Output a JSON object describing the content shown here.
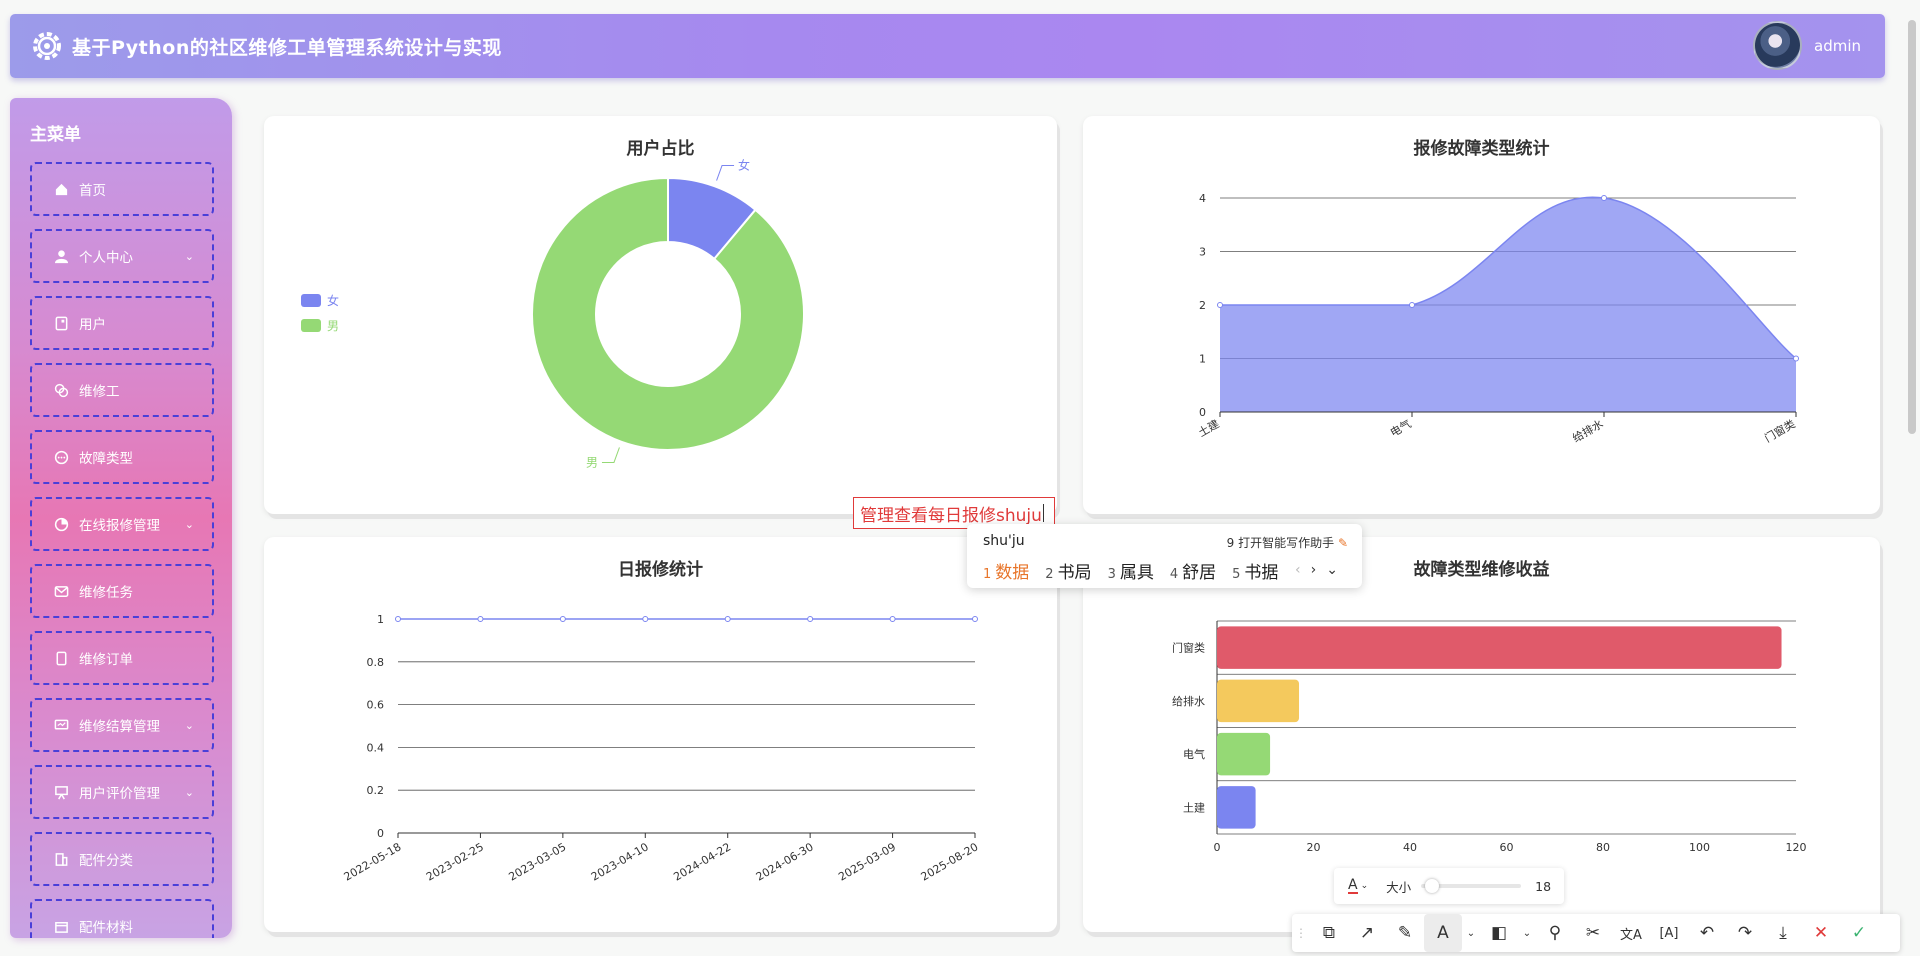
{
  "app": {
    "title": "基于Python的社区维修工单管理系统设计与实现",
    "user": "admin"
  },
  "sidebar": {
    "title": "主菜单",
    "items": [
      {
        "label": "首页",
        "icon": "home-icon",
        "has_children": false
      },
      {
        "label": "个人中心",
        "icon": "user-icon",
        "has_children": true
      },
      {
        "label": "用户",
        "icon": "document-icon",
        "has_children": false
      },
      {
        "label": "维修工",
        "icon": "copy-icon",
        "has_children": false
      },
      {
        "label": "故障类型",
        "icon": "chat-icon",
        "has_children": false
      },
      {
        "label": "在线报修管理",
        "icon": "pie-icon",
        "has_children": true
      },
      {
        "label": "维修任务",
        "icon": "mail-icon",
        "has_children": false
      },
      {
        "label": "维修订单",
        "icon": "phone-icon",
        "has_children": false
      },
      {
        "label": "维修结算管理",
        "icon": "monitor-icon",
        "has_children": true
      },
      {
        "label": "用户评价管理",
        "icon": "presentation-icon",
        "has_children": true
      },
      {
        "label": "配件分类",
        "icon": "building-icon",
        "has_children": false
      },
      {
        "label": "配件材料",
        "icon": "box-icon",
        "has_children": false
      }
    ]
  },
  "chart_data": [
    {
      "id": "user-ratio",
      "type": "pie",
      "title": "用户占比",
      "labels": [
        "女",
        "男"
      ],
      "values": [
        1,
        8
      ],
      "colors": [
        "#7b85f0",
        "#95d975"
      ],
      "legend": "left"
    },
    {
      "id": "fault-type",
      "type": "area",
      "title": "报修故障类型统计",
      "categories": [
        "土建",
        "电气",
        "给排水",
        "门窗类"
      ],
      "values": [
        2,
        2,
        4,
        1
      ],
      "ylim": [
        0,
        4
      ],
      "yticks": [
        "0",
        "1",
        "2",
        "3",
        "4"
      ],
      "color": "#7b85f0"
    },
    {
      "id": "daily-repair",
      "type": "line",
      "title": "日报修统计",
      "categories": [
        "2022-05-18",
        "2023-02-25",
        "2023-03-05",
        "2023-04-10",
        "2024-04-22",
        "2024-06-30",
        "2025-03-09",
        "2025-08-20"
      ],
      "values": [
        1,
        1,
        1,
        1,
        1,
        1,
        1,
        1
      ],
      "ylim": [
        0,
        1
      ],
      "yticks": [
        "0",
        "0.2",
        "0.4",
        "0.6",
        "0.8",
        "1"
      ],
      "color": "#7b85f0"
    },
    {
      "id": "fault-revenue",
      "type": "bar",
      "title": "故障类型维修收益",
      "categories": [
        "土建",
        "电气",
        "给排水",
        "门窗类"
      ],
      "values": [
        8,
        11,
        17,
        117
      ],
      "xlim": [
        0,
        120
      ],
      "xticks": [
        "0",
        "20",
        "40",
        "60",
        "80",
        "100",
        "120"
      ],
      "colors": [
        "#7b85f0",
        "#95d975",
        "#f4c95d",
        "#e05a6a"
      ]
    }
  ],
  "ime": {
    "composing": "管理查看每日报修shuju",
    "pinyin": "shu'ju",
    "assist": "9 打开智能写作助手",
    "candidates": [
      {
        "n": "1",
        "text": "数据"
      },
      {
        "n": "2",
        "text": "书局"
      },
      {
        "n": "3",
        "text": "属具"
      },
      {
        "n": "4",
        "text": "舒居"
      },
      {
        "n": "5",
        "text": "书据"
      }
    ]
  },
  "annotation": {
    "size_label": "大小",
    "size_value": "18",
    "text_color": "#e03a3a",
    "tools": [
      "shape-icon",
      "arrow-icon",
      "pen-icon",
      "text-icon",
      "mosaic-icon",
      "pin-icon",
      "scissors-icon",
      "translate-icon",
      "ocr-icon",
      "undo-icon",
      "redo-icon",
      "download-icon",
      "cancel-icon",
      "confirm-icon"
    ]
  }
}
